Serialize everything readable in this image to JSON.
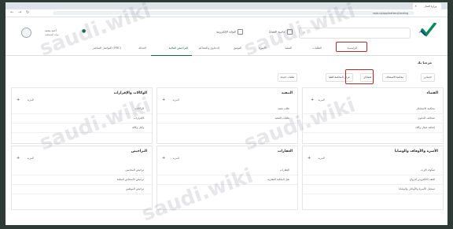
{
  "browser": {
    "tab_title": "وزارة العدل",
    "url": "najiz.sa/applications/landing"
  },
  "header": {
    "logo_text": "ناجز",
    "search_placeholder": "",
    "buttons": [
      "حاسبة القضايا",
      "البوابة الإلكترونية"
    ],
    "user": {
      "name": "أحمد محمد",
      "role": "بوابة المستفيد"
    }
  },
  "tabs": [
    {
      "label": "الرئيسية"
    },
    {
      "label": "الطلبات"
    },
    {
      "label": "التنفيذ"
    },
    {
      "label": "الأسرة"
    },
    {
      "label": "التوثيق"
    },
    {
      "label": "الدعاوى والمحاكم"
    },
    {
      "label": "التراخيص المالية",
      "active": true
    },
    {
      "label": "العدالة"
    },
    {
      "label": "التواصل المباشر (IFRC)"
    }
  ],
  "welcome": "مرحبا بك",
  "chips": [
    "خدماتي",
    "محكمة الاستئناف",
    "قضاياي",
    "عرض المحكمة العليا",
    "طلبات جديدة"
  ],
  "cards": [
    {
      "title": "القضاء",
      "more": "المزيد",
      "items": [
        "محكمة الاستئناف",
        "صحائف الدعوى",
        "إضافة عمال وكلاء"
      ]
    },
    {
      "title": "التنفيذ",
      "more": "المزيد",
      "items": [
        "طلب تنفيذ",
        "طلبات التنفيذ"
      ]
    },
    {
      "title": "الوكالات والإقرارات",
      "more": "المزيد",
      "items": [
        "الوكالات",
        "الإقرارات",
        "وكيل وكالة"
      ]
    },
    {
      "title": "الأسرة والأوقاف والوصايا",
      "more": "المزيد",
      "items": [
        "صكوك الإرث",
        "العقد الالكتروني للزواج",
        "تسجيل الأسرة والأوقاف والوصايا"
      ]
    },
    {
      "title": "العقارات",
      "more": "المزيد",
      "items": [
        "العقارات",
        "نقل الملكية العقارية"
      ]
    },
    {
      "title": "التراخيص",
      "more": "المزيد",
      "items": [
        "ترخيص المحامين",
        "ترخيص الأشخاص المثلثة",
        "ترخيص الموثقين"
      ]
    }
  ],
  "watermark": "saudi.wiki"
}
